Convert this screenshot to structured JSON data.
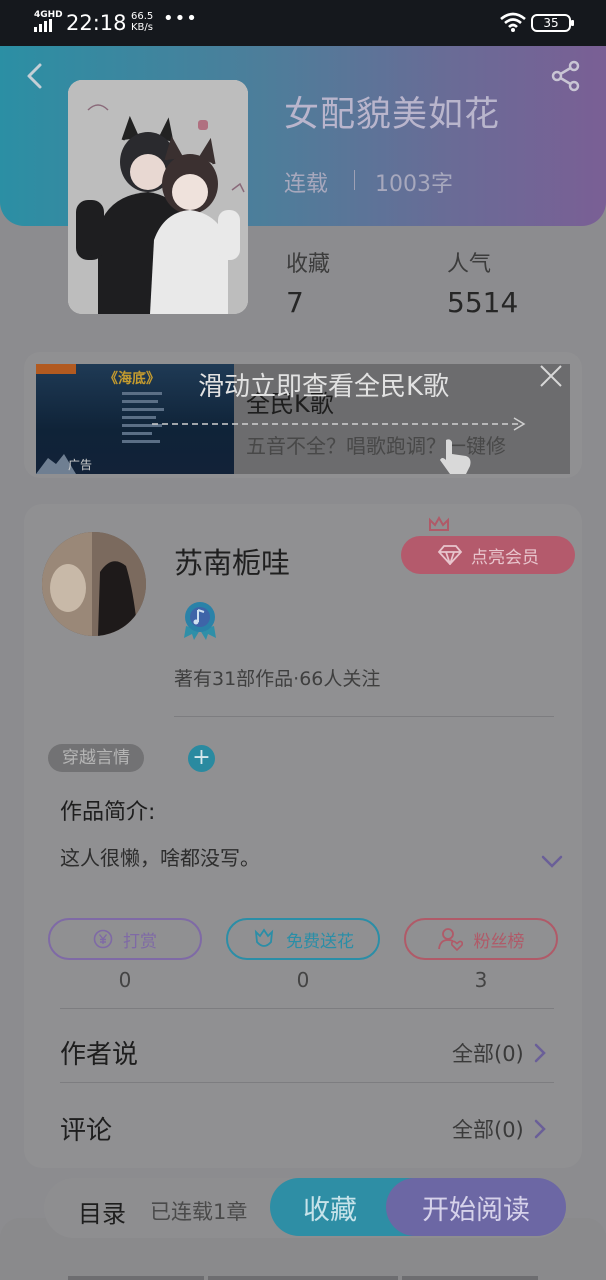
{
  "status_bar": {
    "network": "4GHD",
    "time": "22:18",
    "speed_value": "66.5",
    "speed_unit": "KB/s",
    "more": "•••",
    "battery": "35"
  },
  "book": {
    "title": "女配貌美如花",
    "status": "连载",
    "words": "1003字",
    "stats": [
      {
        "label": "收藏",
        "value": "7"
      },
      {
        "label": "人气",
        "value": "5514"
      }
    ]
  },
  "ad": {
    "overlay_text": "滑动立即查看全民K歌",
    "title": "全民K歌",
    "description": "五音不全？唱歌跑调？一键修",
    "label": "广告",
    "poster_title": "《海底》"
  },
  "author": {
    "name": "苏南栀哇",
    "vip_label": "点亮会员",
    "meta": "著有31部作品·66人关注",
    "tag": "穿越言情",
    "add_tag": "+",
    "intro_label": "作品简介:",
    "intro_text": "这人很懒，啥都没写。"
  },
  "actions": [
    {
      "label": "打赏",
      "count": "0",
      "icon": "yen-icon",
      "color": "#7f6aa6"
    },
    {
      "label": "免费送花",
      "count": "0",
      "icon": "flower-icon",
      "color": "#2b8ea7"
    },
    {
      "label": "粉丝榜",
      "count": "3",
      "icon": "fans-icon",
      "color": "#b05a68"
    }
  ],
  "rows": {
    "author_says": {
      "label": "作者说",
      "link": "全部(0)"
    },
    "comments": {
      "label": "评论",
      "link": "全部(0)"
    }
  },
  "bottom_bar": {
    "toc": "目录",
    "toc_sub": "已连载1章",
    "favorite": "收藏",
    "read": "开始阅读"
  },
  "colors": {
    "header_start": "#2b8fa4",
    "header_end": "#7a5f95",
    "accent_teal": "#2e8ea5",
    "accent_purple": "#6c67a4",
    "vip_red": "#b45a6c"
  }
}
